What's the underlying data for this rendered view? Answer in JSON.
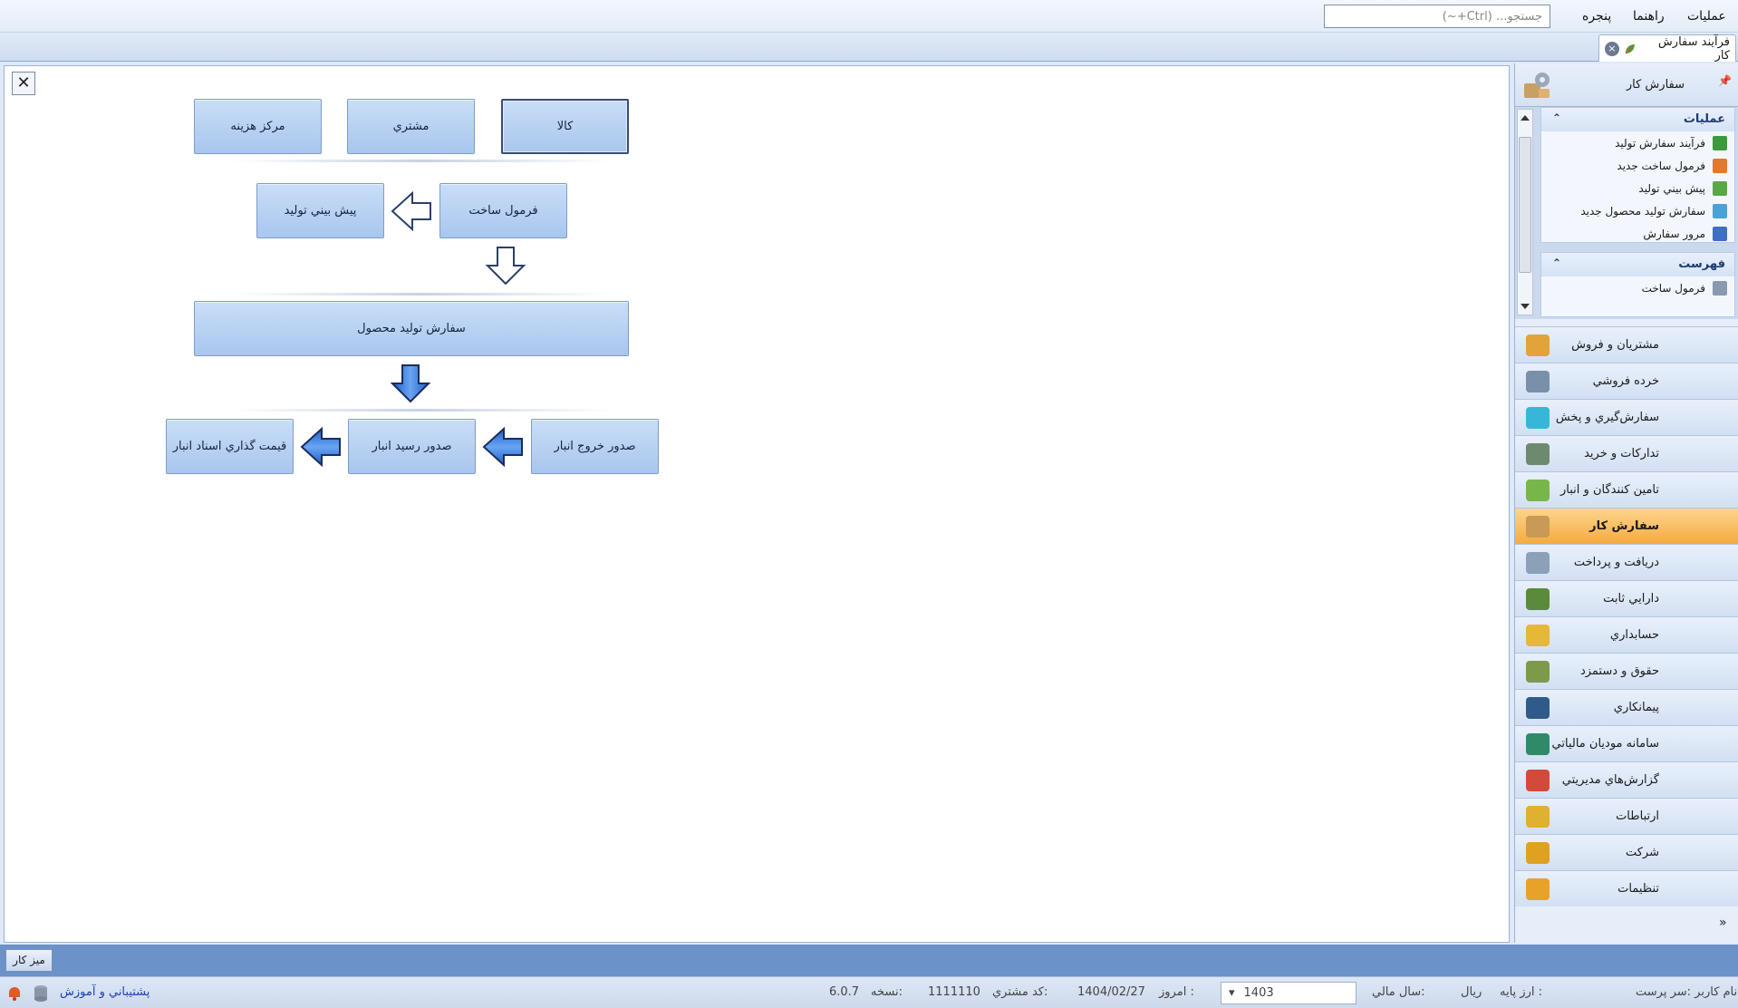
{
  "menu": {
    "operations": "عمليات",
    "help": "راهنما",
    "window": "پنجره",
    "search_placeholder": "جستجو... (Ctrl+~)"
  },
  "document_tab": {
    "label": "فرآيند سفارش کار",
    "close": "×"
  },
  "workflow": {
    "close": "✕",
    "goods": "کالا",
    "customer": "مشتري",
    "cost_center": "مرکز هزينه",
    "build_formula": "فرمول ساخت",
    "production_forecast": "پيش بيني توليد",
    "product_production_order": "سفارش توليد محصول",
    "warehouse_issue": "صدور خروج انبار",
    "warehouse_receipt": "صدور رسيد انبار",
    "warehouse_doc_pricing": "قيمت گذاري اسناد انبار"
  },
  "nav": {
    "header_title": "سفارش کار",
    "pin": "📌",
    "operations_group": {
      "title": "عمليات",
      "chevron": "⌃",
      "items": [
        {
          "label": "فرآيند سفارش توليد",
          "icon": "production-process-icon",
          "color": "#3b9a3b"
        },
        {
          "label": "فرمول ساخت جديد",
          "icon": "new-formula-icon",
          "color": "#e07a2e"
        },
        {
          "label": "پيش بيني توليد",
          "icon": "forecast-icon",
          "color": "#5aa74a"
        },
        {
          "label": "سفارش توليد محصول جديد",
          "icon": "new-order-icon",
          "color": "#4aa3d4"
        },
        {
          "label": "مرور سفارش",
          "icon": "review-order-icon",
          "color": "#3f6fc4"
        }
      ]
    },
    "list_group": {
      "title": "فهرست",
      "chevron": "⌃",
      "items": [
        {
          "label": "فرمول ساخت",
          "icon": "list-icon",
          "color": "#8899b0"
        }
      ]
    },
    "modules": [
      {
        "label": "مشتريان و فروش",
        "icon": "customers-sales-icon",
        "color": "#e2a33a"
      },
      {
        "label": "خرده فروشي",
        "icon": "retail-icon",
        "color": "#7a8faa"
      },
      {
        "label": "سفارش‌گيري و پخش",
        "icon": "distribution-icon",
        "color": "#35b8d8"
      },
      {
        "label": "تدارکات و خريد",
        "icon": "procurement-icon",
        "color": "#6e8a6e"
      },
      {
        "label": "تامين کنندگان و انبار",
        "icon": "suppliers-icon",
        "color": "#79b64a"
      },
      {
        "label": "سفارش کار",
        "icon": "work-order-icon",
        "color": "#c89a55",
        "active": true
      },
      {
        "label": "دريافت و پرداخت",
        "icon": "payments-icon",
        "color": "#8ca0b8"
      },
      {
        "label": "دارايي ثابت",
        "icon": "fixed-assets-icon",
        "color": "#5a8a3a"
      },
      {
        "label": "حسابداري",
        "icon": "accounting-icon",
        "color": "#e5b83a"
      },
      {
        "label": "حقوق و دستمزد",
        "icon": "payroll-icon",
        "color": "#7c9a4a"
      },
      {
        "label": "پيمانکاري",
        "icon": "contracting-icon",
        "color": "#2f5a8a"
      },
      {
        "label": "سامانه موديان مالياتي",
        "icon": "tax-system-icon",
        "color": "#2f8a6a"
      },
      {
        "label": "گزارش‌هاي مديريتي",
        "icon": "reports-icon",
        "color": "#d44a3a"
      },
      {
        "label": "ارتباطات",
        "icon": "communications-icon",
        "color": "#e0b030"
      },
      {
        "label": "شرکت",
        "icon": "company-icon",
        "color": "#e0a020"
      },
      {
        "label": "تنظيمات",
        "icon": "settings-icon",
        "color": "#e8a22a"
      }
    ],
    "more": "»"
  },
  "taskbar": {
    "desktop": "ميز کار"
  },
  "status": {
    "user": "نام کاربر :سر پرست",
    "base_currency_label": "ارز پايه :",
    "base_currency": "ريال",
    "fiscal_year_label": "سال مالي:",
    "fiscal_year": "1403",
    "today_label": "امروز :",
    "today": "1404/02/27",
    "customer_code_label": "کد مشتري:",
    "customer_code": "1111110",
    "version_label": "نسخه:",
    "version": "6.0.7",
    "support": "پشتيباني و آموزش"
  }
}
